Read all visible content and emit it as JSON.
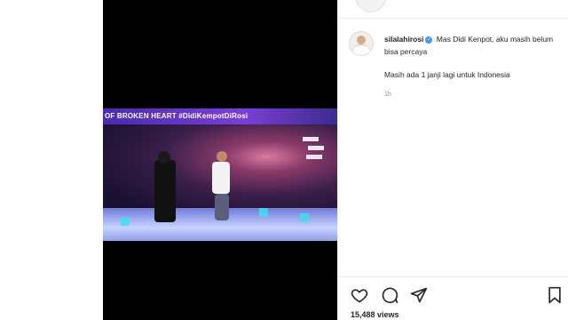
{
  "video": {
    "banner_text": "OF BROKEN HEART #DidiKempotDiRosi"
  },
  "comment": {
    "username": "silalahirosi",
    "verified_mark": "✓",
    "text": "Mas Didi Kenpot, aku masih belum bisa percaya",
    "text_line2": "Masih ada 1 janji lagi untuk Indonesia",
    "time": "1h"
  },
  "actions": {
    "icons": [
      "heart-icon",
      "comment-icon",
      "share-icon",
      "bookmark-icon"
    ]
  },
  "stats": {
    "views": "15,488 views"
  }
}
